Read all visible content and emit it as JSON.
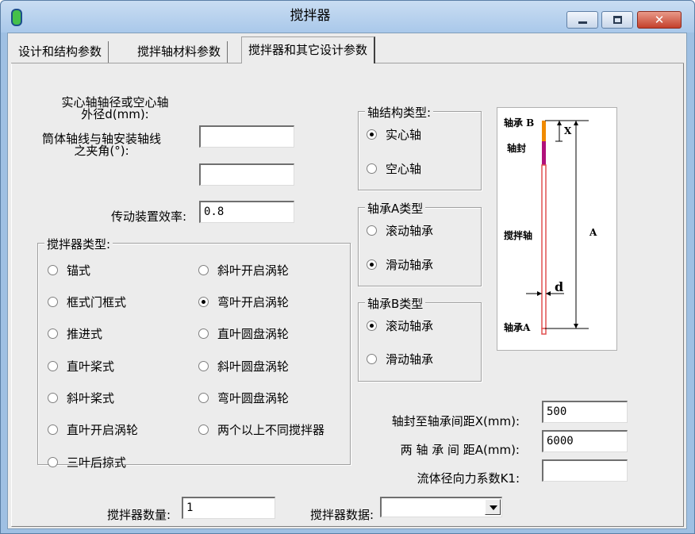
{
  "window": {
    "title": "搅拌器",
    "close_glyph": "✕"
  },
  "tabs": [
    {
      "label": "设计和结构参数"
    },
    {
      "label": "搅拌轴材料参数"
    },
    {
      "label": "搅拌器和其它设计参数"
    }
  ],
  "fields": {
    "shaft_diameter": {
      "label_line1": "实心轴轴径或空心轴",
      "label_line2": "外径d(mm):",
      "value": ""
    },
    "angle": {
      "label_line1": "筒体轴线与轴安装轴线",
      "label_line2": "之夹角(°):",
      "value": ""
    },
    "efficiency": {
      "label": "传动装置效率:",
      "value": "0.8"
    }
  },
  "agitator_type": {
    "legend": "搅拌器类型:",
    "options": [
      {
        "label": "锚式",
        "checked": false
      },
      {
        "label": "斜叶开启涡轮",
        "checked": false
      },
      {
        "label": "框式门框式",
        "checked": false
      },
      {
        "label": "弯叶开启涡轮",
        "checked": true
      },
      {
        "label": "推进式",
        "checked": false
      },
      {
        "label": "直叶圆盘涡轮",
        "checked": false
      },
      {
        "label": "直叶桨式",
        "checked": false
      },
      {
        "label": "斜叶圆盘涡轮",
        "checked": false
      },
      {
        "label": "斜叶桨式",
        "checked": false
      },
      {
        "label": "弯叶圆盘涡轮",
        "checked": false
      },
      {
        "label": "直叶开启涡轮",
        "checked": false
      },
      {
        "label": "两个以上不同搅拌器",
        "checked": false
      },
      {
        "label": "三叶后掠式",
        "checked": false
      }
    ]
  },
  "shaft_structure": {
    "legend": "轴结构类型:",
    "options": [
      {
        "label": "实心轴",
        "checked": true
      },
      {
        "label": "空心轴",
        "checked": false
      }
    ]
  },
  "bearing_a": {
    "legend": "轴承A类型",
    "options": [
      {
        "label": "滚动轴承",
        "checked": false
      },
      {
        "label": "滑动轴承",
        "checked": true
      }
    ]
  },
  "bearing_b": {
    "legend": "轴承B类型",
    "options": [
      {
        "label": "滚动轴承",
        "checked": true
      },
      {
        "label": "滑动轴承",
        "checked": false
      }
    ]
  },
  "right_fields": {
    "seal_distance": {
      "label": "轴封至轴承间距X(mm):",
      "value": "500"
    },
    "bearing_distance": {
      "label": "两 轴 承 间 距A(mm):",
      "value": "6000"
    },
    "radial_force": {
      "label": "流体径向力系数K1:",
      "value": ""
    }
  },
  "bottom": {
    "count_label": "搅拌器数量:",
    "count_value": "1",
    "data_label": "搅拌器数据:",
    "data_value": ""
  },
  "diagram": {
    "bearing_b": "轴承 B",
    "seal": "轴封",
    "shaft": "搅拌轴",
    "bearing_a": "轴承A",
    "x": "X",
    "a": "A",
    "d": "d"
  },
  "colors": {
    "title_bg": "#a9c8ea",
    "client_bg": "#ececec",
    "shaft": "#e05050",
    "seal": "#b0107a",
    "bearing_b": "#f08a00"
  }
}
